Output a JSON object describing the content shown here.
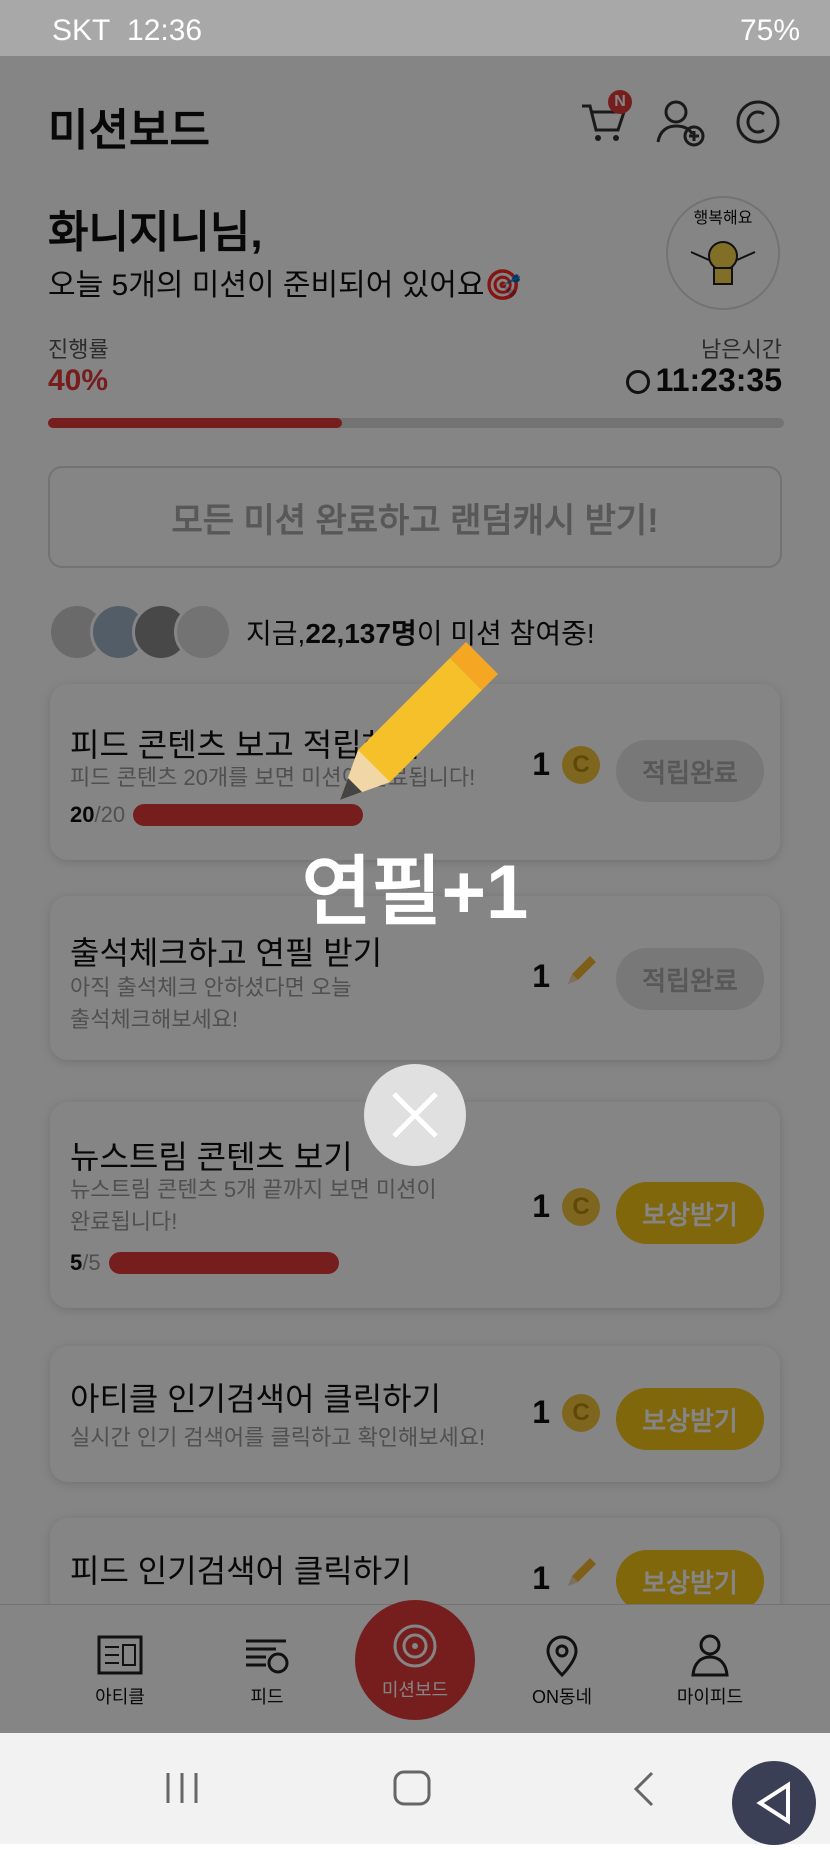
{
  "status_bar": {
    "carrier": "SKT",
    "time": "12:36",
    "battery": "75%"
  },
  "header": {
    "title": "미션보드",
    "cart_badge": "N"
  },
  "greeting": {
    "name": "화니지니님,",
    "subtitle": "오늘 5개의 미션이 준비되어 있어요🎯",
    "avatar_text": "행복해요"
  },
  "progress": {
    "label": "진행률",
    "value": "40%",
    "fraction": 0.4,
    "time_label": "남은시간",
    "time_left": "11:23:35"
  },
  "all_missions_button": "모든 미션 완료하고 랜덤캐시 받기!",
  "participants": {
    "prefix": "지금, ",
    "count": "22,137명",
    "suffix": "이 미션 참여중!"
  },
  "missions": [
    {
      "title": "피드 콘텐츠 보고 적립하기",
      "desc": "피드 콘텐츠 20개를 보면 미션이 완료됩니다!",
      "progress_done": "20",
      "progress_total": "/20",
      "progress_fraction": 1.0,
      "reward": "1",
      "reward_icon": "coin-icon",
      "button": "적립완료"
    },
    {
      "title": "출석체크하고 연필 받기",
      "desc": "아직 출석체크 안하셨다면 오늘 출석체크해보세요!",
      "reward": "1",
      "reward_icon": "pencil-icon",
      "button": "적립완료"
    },
    {
      "title": "뉴스트림 콘텐츠 보기",
      "desc": "뉴스트림 콘텐츠 5개 끝까지 보면 미션이 완료됩니다!",
      "progress_done": "5",
      "progress_total": "/5",
      "progress_fraction": 1.0,
      "reward": "1",
      "reward_icon": "coin-icon",
      "button": "보상받기"
    },
    {
      "title": "아티클 인기검색어 클릭하기",
      "desc": "실시간 인기 검색어를 클릭하고 확인해보세요!",
      "reward": "1",
      "reward_icon": "coin-icon",
      "button": "보상받기"
    },
    {
      "title": "피드 인기검색어 클릭하기",
      "desc": "",
      "reward": "1",
      "reward_icon": "pencil-icon",
      "button": "보상받기"
    }
  ],
  "bottom_nav": {
    "article": "아티클",
    "feed": "피드",
    "missionboard": "미션보드",
    "on_neighborhood": "ON동네",
    "my_feed": "마이피드"
  },
  "overlay": {
    "reward_text": "연필+1"
  },
  "colors": {
    "accent_red": "#e23b3b",
    "reward_yellow": "#f5c518"
  }
}
